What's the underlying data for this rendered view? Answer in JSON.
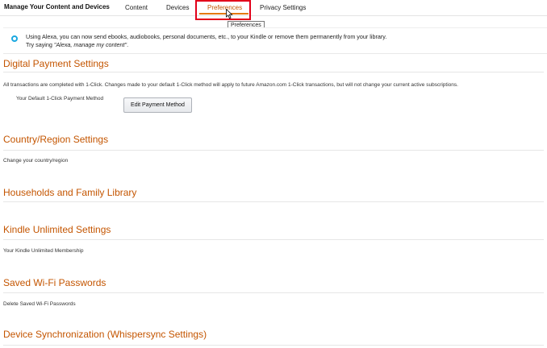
{
  "header": {
    "brand": "Manage Your Content and Devices",
    "tabs": [
      {
        "label": "Content"
      },
      {
        "label": "Devices"
      },
      {
        "label": "Preferences"
      },
      {
        "label": "Privacy Settings"
      }
    ],
    "tooltip": "Preferences"
  },
  "alexa": {
    "line1": "Using Alexa, you can now send ebooks, audiobooks, personal documents, etc., to your Kindle or remove them permanently from your library.",
    "line2_prefix": "Try saying ",
    "line2_quote": "\"Alexa, manage my content\"",
    "line2_suffix": "."
  },
  "sections": {
    "payment": {
      "title": "Digital Payment Settings",
      "description": "All transactions are completed with 1-Click. Changes made to your default 1-Click method will apply to future Amazon.com 1-Click transactions, but will not change your current active subscriptions.",
      "field_label": "Your Default 1-Click Payment Method",
      "button_label": "Edit Payment Method"
    },
    "country": {
      "title": "Country/Region Settings",
      "description": "Change your country/region"
    },
    "households": {
      "title": "Households and Family Library"
    },
    "kindle_unlimited": {
      "title": "Kindle Unlimited Settings",
      "description": "Your Kindle Unlimited Membership"
    },
    "wifi": {
      "title": "Saved Wi-Fi Passwords",
      "description": "Delete Saved Wi-Fi Passwords"
    },
    "sync": {
      "title": "Device Synchronization (Whispersync Settings)"
    }
  }
}
